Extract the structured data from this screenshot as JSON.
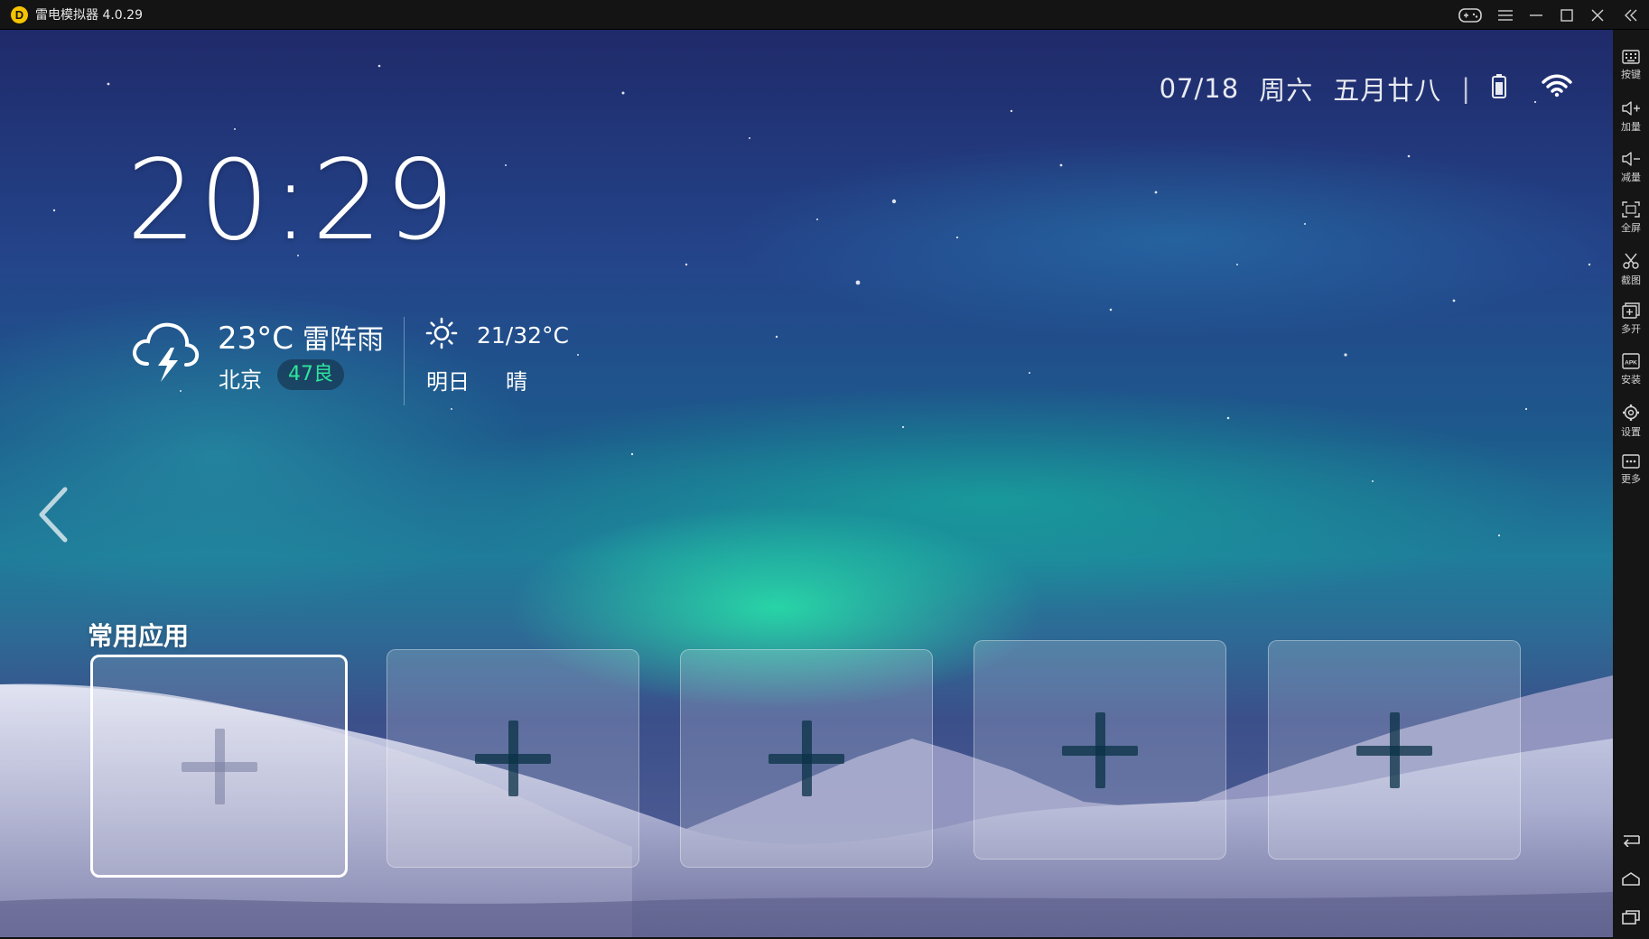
{
  "window": {
    "title": "雷电模拟器 4.0.29",
    "logo_letter": "D",
    "controls": [
      "gamepad-icon",
      "menu-icon",
      "minimize-icon",
      "maximize-icon",
      "close-icon",
      "collapse-icon"
    ]
  },
  "status_bar": {
    "date": "07/18",
    "weekday": "周六",
    "lunar_date": "五月廿八",
    "separator": "|",
    "icons": [
      "battery-icon",
      "wifi-icon"
    ]
  },
  "clock": {
    "time": "20:29"
  },
  "weather": {
    "current_temp": "23°C",
    "current_condition": "雷阵雨",
    "city": "北京",
    "aqi": "47良",
    "tomorrow_range": "21/32°C",
    "tomorrow_label": "明日",
    "tomorrow_condition": "晴",
    "colors": {
      "aqi_text": "#2ee59d"
    }
  },
  "apps": {
    "title": "常用应用",
    "slots": [
      "add-app-slot-1",
      "add-app-slot-2",
      "add-app-slot-3",
      "add-app-slot-4",
      "add-app-slot-5"
    ]
  },
  "sidebar": {
    "items": [
      {
        "label": "按键",
        "icon": "keyboard-icon"
      },
      {
        "label": "加量",
        "icon": "volume-up-icon"
      },
      {
        "label": "减量",
        "icon": "volume-down-icon"
      },
      {
        "label": "全屏",
        "icon": "fullscreen-icon"
      },
      {
        "label": "截图",
        "icon": "scissors-icon"
      },
      {
        "label": "多开",
        "icon": "multi-instance-icon"
      },
      {
        "label": "安装",
        "icon": "apk-install-icon"
      },
      {
        "label": "设置",
        "icon": "gear-icon"
      },
      {
        "label": "更多",
        "icon": "more-icon"
      }
    ],
    "nav": [
      "back-icon",
      "home-icon",
      "recent-apps-icon"
    ]
  }
}
